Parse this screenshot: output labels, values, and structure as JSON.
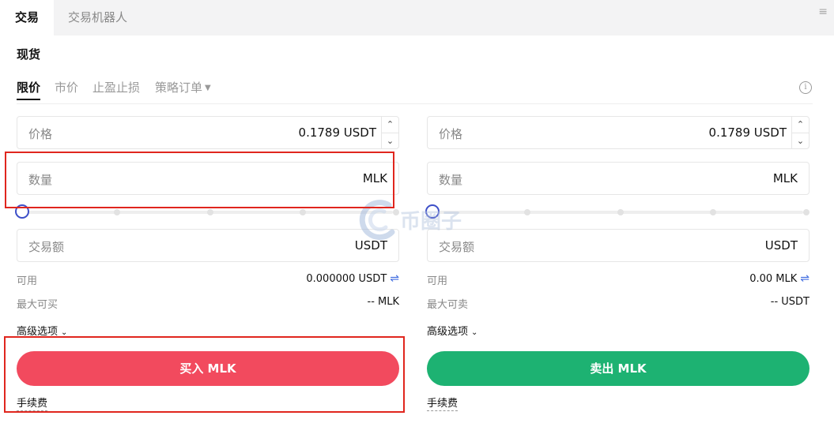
{
  "tabs": [
    {
      "label": "交易",
      "active": true
    },
    {
      "label": "交易机器人",
      "active": false
    }
  ],
  "section_title": "现货",
  "order_types": [
    {
      "label": "限价",
      "active": true
    },
    {
      "label": "市价",
      "active": false
    },
    {
      "label": "止盈止损",
      "active": false
    },
    {
      "label": "策略订单",
      "active": false
    }
  ],
  "buy": {
    "price_label": "价格",
    "price_value": "0.1789 USDT",
    "amount_label": "数量",
    "amount_unit": "MLK",
    "slider_percent": 0,
    "total_label": "交易额",
    "total_unit": "USDT",
    "available_label": "可用",
    "available_value": "0.000000 USDT",
    "max_label": "最大可买",
    "max_value": "-- MLK",
    "advanced_label": "高级选项",
    "button_label": "买入 MLK",
    "fee_label": "手续费"
  },
  "sell": {
    "price_label": "价格",
    "price_value": "0.1789 USDT",
    "amount_label": "数量",
    "amount_unit": "MLK",
    "slider_percent": 0,
    "total_label": "交易额",
    "total_unit": "USDT",
    "available_label": "可用",
    "available_value": "0.00 MLK",
    "max_label": "最大可卖",
    "max_value": "-- USDT",
    "advanced_label": "高级选项",
    "button_label": "卖出 MLK",
    "fee_label": "手续费"
  },
  "watermark_text": "币圈子",
  "colors": {
    "buy": "#f24a5e",
    "sell": "#1db272",
    "highlight": "#e0261e",
    "slider_knob": "#3d4fc8"
  },
  "icons": {
    "menu": "menu-icon",
    "info": "info-icon",
    "swap": "swap-icon",
    "chevron": "chevron-down-icon"
  }
}
